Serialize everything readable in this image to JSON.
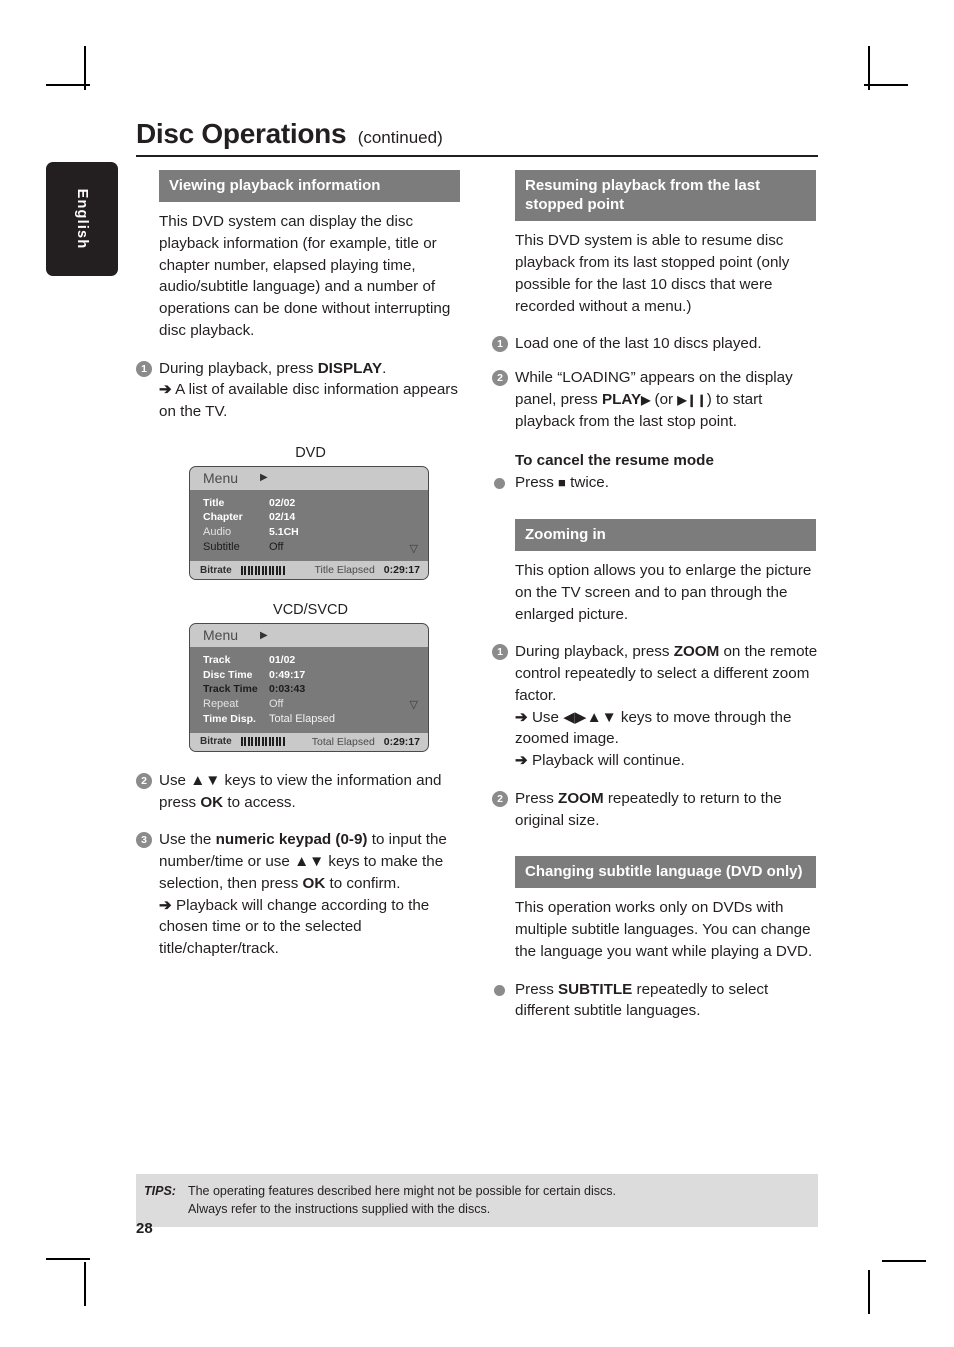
{
  "page": {
    "title_main": "Disc Operations",
    "title_continued": "(continued)",
    "language_tab": "English",
    "page_number": "28"
  },
  "tips": {
    "label": "TIPS:",
    "line1": "The operating features described here might not be possible for certain discs.",
    "line2": "Always refer to the instructions supplied with the discs."
  },
  "left_column": {
    "section1": {
      "heading": "Viewing playback information",
      "intro": "This DVD system can display the disc playback information (for example, title or chapter number, elapsed playing time, audio/subtitle language) and a number of operations can be done without interrupting disc playback.",
      "step1": {
        "num": "1",
        "text_a": "During playback, press ",
        "bold": "DISPLAY",
        "text_b": ".",
        "result": "A list of available disc information appears on the TV."
      },
      "step2": {
        "num": "2",
        "text_a": "Use ",
        "keys": "▲▼",
        "text_b": " keys to view the information and press ",
        "bold": "OK",
        "text_c": " to access."
      },
      "step3": {
        "num": "3",
        "text_a": "Use the ",
        "bold1": "numeric keypad (0-9)",
        "text_b": " to input the number/time or use ",
        "keys": "▲▼",
        "text_c": " keys to make the selection, then press ",
        "bold2": "OK",
        "text_d": " to confirm.",
        "result": "Playback will change according to the chosen time or to the selected title/chapter/track."
      }
    },
    "osd_dvd": {
      "caption": "DVD",
      "menu_label": "Menu",
      "rows": [
        {
          "key": "Title",
          "value": "02/02",
          "style": "bright"
        },
        {
          "key": "Chapter",
          "value": "02/14",
          "style": "bright"
        },
        {
          "key": "Audio",
          "value": "5.1CH",
          "style": "dim"
        },
        {
          "key": "Subtitle",
          "value": "Off",
          "style": "dark"
        }
      ],
      "footer_label": "Bitrate",
      "footer_mode": "Title Elapsed",
      "footer_time": "0:29:17"
    },
    "osd_vcd": {
      "caption": "VCD/SVCD",
      "menu_label": "Menu",
      "rows": [
        {
          "key": "Track",
          "value": "01/02",
          "style": "bright"
        },
        {
          "key": "Disc Time",
          "value": "0:49:17",
          "style": "bright"
        },
        {
          "key": "Track Time",
          "value": "0:03:43",
          "style": "dark"
        },
        {
          "key": "Repeat",
          "value": "Off",
          "style": "dim"
        },
        {
          "key": "Time Disp.",
          "value": "Total Elapsed",
          "style": "bright"
        }
      ],
      "footer_label": "Bitrate",
      "footer_mode": "Total Elapsed",
      "footer_time": "0:29:17"
    }
  },
  "right_column": {
    "section_resume": {
      "heading": "Resuming playback from the last stopped point",
      "intro": "This DVD system is able to resume disc playback from its last stopped point (only possible for the last 10 discs that were recorded without a menu.)",
      "step1": {
        "num": "1",
        "text": "Load one of the last 10 discs played."
      },
      "step2": {
        "num": "2",
        "text_a": "While “LOADING” appears on the display panel, press ",
        "bold": "PLAY",
        "glyph_play": "▶",
        "text_b": " (or ",
        "glyph_playpause": "▶❙❙",
        "text_c": ") to start playback from the last stop point."
      },
      "cancel_head": "To cancel the resume mode",
      "cancel_text_a": "Press ",
      "cancel_glyph": "■",
      "cancel_text_b": " twice."
    },
    "section_zoom": {
      "heading": "Zooming in",
      "intro": "This option allows you to enlarge the picture on the TV screen and to pan through the enlarged picture.",
      "step1": {
        "num": "1",
        "text_a": "During playback, press ",
        "bold": "ZOOM",
        "text_b": " on the remote control repeatedly to select a different zoom factor.",
        "result1_a": "Use ",
        "result1_keys": "◀▶▲▼",
        "result1_b": " keys to move through the zoomed image.",
        "result2": "Playback will continue."
      },
      "step2": {
        "num": "2",
        "text_a": "Press ",
        "bold": "ZOOM",
        "text_b": " repeatedly to return to the original size."
      }
    },
    "section_subtitle": {
      "heading": "Changing subtitle language (DVD only)",
      "intro": "This operation works only on DVDs with multiple subtitle languages. You can change the language you want while playing a DVD.",
      "bullet_a": "Press ",
      "bullet_bold": "SUBTITLE",
      "bullet_b": " repeatedly to select different subtitle languages."
    }
  },
  "colors": {
    "section_header_bg": "#7c7c7c",
    "tips_bg": "#dcdcdc",
    "tab_bg": "#231f20",
    "osd_body": "#7a7a7a",
    "osd_bar": "#c9c9c9"
  }
}
